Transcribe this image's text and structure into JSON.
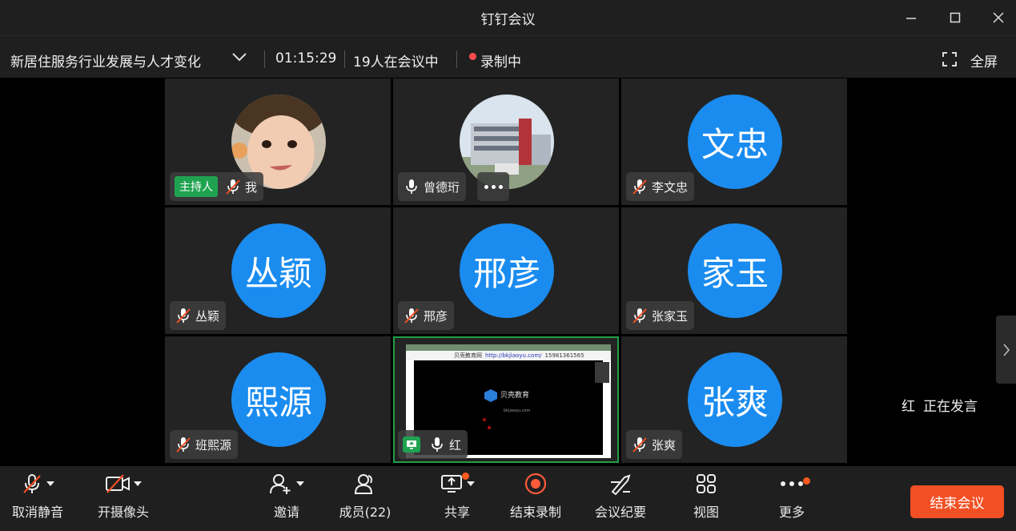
{
  "window": {
    "title": "钉钉会议"
  },
  "meeting": {
    "name": "新居住服务行业发展与人才变化",
    "duration": "01:15:29",
    "participants_text": "19人在会议中",
    "recording_text": "录制中",
    "fullscreen_label": "全屏"
  },
  "host_badge": "主持人",
  "tiles": [
    {
      "name": "我",
      "avatar": "photo-child",
      "muted": true,
      "host": true
    },
    {
      "name": "曾德珩",
      "avatar": "photo-building",
      "muted": false
    },
    {
      "name": "李文忠",
      "avatar_text": "文忠",
      "muted": true
    },
    {
      "name": "丛颖",
      "avatar_text": "丛颖",
      "muted": true
    },
    {
      "name": "邢彦",
      "avatar_text": "邢彦",
      "muted": true
    },
    {
      "name": "张家玉",
      "avatar_text": "家玉",
      "muted": true
    },
    {
      "name": "班熙源",
      "avatar_text": "熙源",
      "muted": true
    },
    {
      "name": "红",
      "screen_share": true,
      "muted": false,
      "active_speaker": true
    },
    {
      "name": "张爽",
      "avatar_text": "张爽",
      "muted": true
    }
  ],
  "shared_screen": {
    "url_prefix": "贝壳教育网",
    "url": "http://bkjiaoyu.com/",
    "phone": "15981361565",
    "logo_text": "贝壳教育",
    "logo_sub": "bkjiaoyu.com"
  },
  "speaking": {
    "name": "红",
    "status": "正在发言"
  },
  "toolbar": {
    "unmute": "取消静音",
    "camera": "开摄像头",
    "invite": "邀请",
    "members": "成员(22)",
    "share": "共享",
    "stop_recording": "结束录制",
    "minutes": "会议纪要",
    "view": "视图",
    "more": "更多",
    "end": "结束会议"
  },
  "colors": {
    "avatar_blue": "#1a8cf0",
    "host_green": "#20a351",
    "end_orange": "#f24f24",
    "recording_red": "#ff4d4f"
  }
}
